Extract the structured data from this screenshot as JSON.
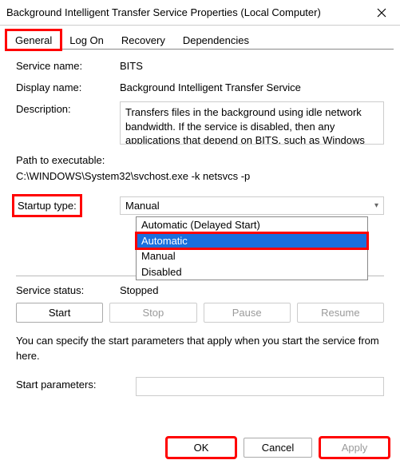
{
  "window": {
    "title": "Background Intelligent Transfer Service Properties (Local Computer)"
  },
  "tabs": {
    "general": "General",
    "logon": "Log On",
    "recovery": "Recovery",
    "dependencies": "Dependencies"
  },
  "labels": {
    "service_name": "Service name:",
    "display_name": "Display name:",
    "description": "Description:",
    "path_to_exe": "Path to executable:",
    "startup_type": "Startup type:",
    "service_status": "Service status:",
    "start_parameters": "Start parameters:"
  },
  "values": {
    "service_name": "BITS",
    "display_name": "Background Intelligent Transfer Service",
    "description": "Transfers files in the background using idle network bandwidth. If the service is disabled, then any applications that depend on BITS, such as Windows",
    "path": "C:\\WINDOWS\\System32\\svchost.exe -k netsvcs -p",
    "startup_selected": "Manual",
    "service_status": "Stopped"
  },
  "startup_options": {
    "delayed": "Automatic (Delayed Start)",
    "automatic": "Automatic",
    "manual": "Manual",
    "disabled": "Disabled"
  },
  "buttons": {
    "start": "Start",
    "stop": "Stop",
    "pause": "Pause",
    "resume": "Resume",
    "ok": "OK",
    "cancel": "Cancel",
    "apply": "Apply"
  },
  "note": "You can specify the start parameters that apply when you start the service from here."
}
